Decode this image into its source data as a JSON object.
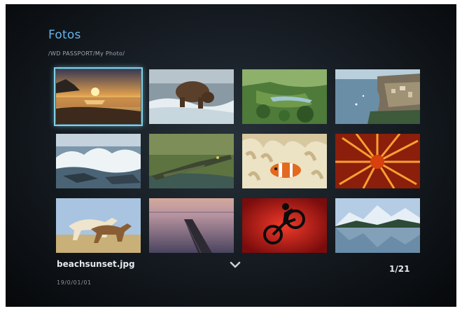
{
  "header": {
    "title": "Fotos",
    "path": "/WD PASSPORT/My Photo/"
  },
  "grid": {
    "rows": 3,
    "columns": 4,
    "thumbnails": [
      {
        "icon": "beach-sunset-photo",
        "selected": true
      },
      {
        "icon": "bear-in-river-photo",
        "selected": false
      },
      {
        "icon": "aerial-landscape-photo",
        "selected": false
      },
      {
        "icon": "coastal-town-photo",
        "selected": false
      },
      {
        "icon": "ocean-waves-photo",
        "selected": false
      },
      {
        "icon": "crocodile-photo",
        "selected": false
      },
      {
        "icon": "clownfish-anemone-photo",
        "selected": false
      },
      {
        "icon": "red-sea-creature-photo",
        "selected": false
      },
      {
        "icon": "horses-running-photo",
        "selected": false
      },
      {
        "icon": "lake-pier-photo",
        "selected": false
      },
      {
        "icon": "bmx-rider-photo",
        "selected": false
      },
      {
        "icon": "mountain-lake-photo",
        "selected": false
      }
    ]
  },
  "footer": {
    "filename": "beachsunset.jpg",
    "date": "19/0/01/01",
    "counter": "1/21",
    "scroll_icon": "chevron-down-icon"
  }
}
